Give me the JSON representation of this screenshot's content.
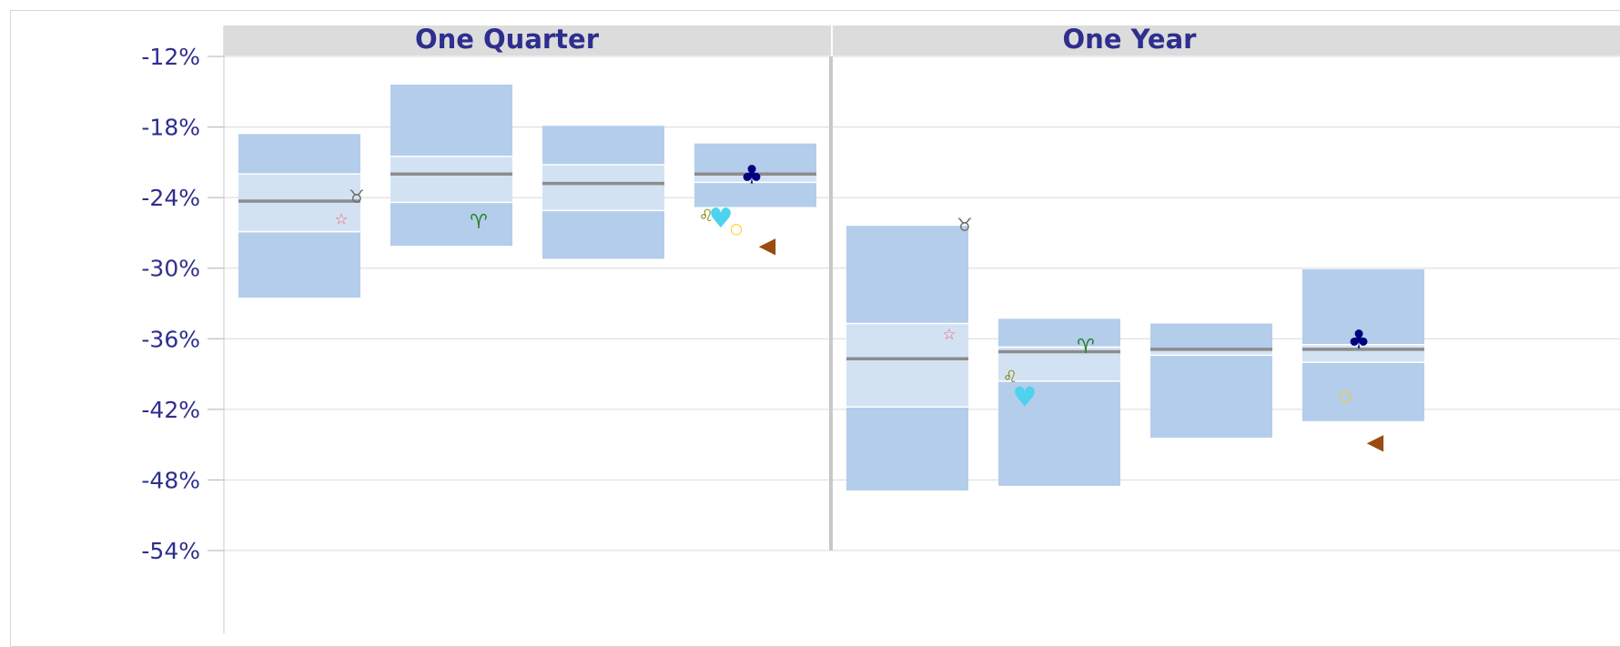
{
  "chart_data": {
    "type": "box",
    "panels": [
      "One Quarter",
      "One Year"
    ],
    "y_ticks": [
      "-12%",
      "-18%",
      "-24%",
      "-30%",
      "-36%",
      "-42%",
      "-48%",
      "-54%"
    ],
    "ylim": [
      -54,
      -12
    ],
    "grid": true,
    "colors": {
      "box_outer": "#b3cdeb",
      "box_inner": "#d3e2f3",
      "median": "#8c8c8c",
      "divider": "#c8c8c8",
      "header_bg": "#dcdcdc",
      "text": "#2e2e8f"
    },
    "boxes": [
      {
        "panel": 0,
        "slot": 0,
        "top": -18.6,
        "q3": -22,
        "median": -24.3,
        "q1": -26.9,
        "bottom": -32.5
      },
      {
        "panel": 0,
        "slot": 1,
        "top": -14.4,
        "q3": -20.5,
        "median": -22,
        "q1": -24.4,
        "bottom": -28.1
      },
      {
        "panel": 0,
        "slot": 2,
        "top": -17.9,
        "q3": -21.2,
        "median": -22.8,
        "q1": -25.1,
        "bottom": -29.2
      },
      {
        "panel": 0,
        "slot": 3,
        "top": -19.4,
        "q3": null,
        "median": -22,
        "q1": -22.7,
        "bottom": -24.8
      },
      {
        "panel": 1,
        "slot": 0,
        "top": -26.4,
        "q3": -34.7,
        "median": -37.7,
        "q1": -41.8,
        "bottom": -48.9
      },
      {
        "panel": 1,
        "slot": 1,
        "top": -34.3,
        "q3": -36.7,
        "median": -37.1,
        "q1": -39.6,
        "bottom": -48.5
      },
      {
        "panel": 1,
        "slot": 2,
        "top": -34.7,
        "q3": null,
        "median": -36.9,
        "q1": -37.4,
        "bottom": -44.4
      },
      {
        "panel": 1,
        "slot": 3,
        "top": -30.1,
        "q3": -36.5,
        "median": -36.9,
        "q1": -38,
        "bottom": -43
      }
    ],
    "markers": [
      {
        "panel": 0,
        "slot": 0,
        "symbol": "♉",
        "color": "#707070",
        "value": -23.9
      },
      {
        "panel": 0,
        "slot": 0,
        "symbol": "☆",
        "color": "#f06070",
        "value": -25.8
      },
      {
        "panel": 0,
        "slot": 1,
        "symbol": "♈",
        "color": "#2a7d2a",
        "value": -26
      },
      {
        "panel": 0,
        "slot": 3,
        "symbol": "♣",
        "color": "#000080",
        "value": -22
      },
      {
        "panel": 0,
        "slot": 3,
        "symbol": "♌",
        "color": "#808000",
        "value": -25.5
      },
      {
        "panel": 0,
        "slot": 3,
        "symbol": "♥",
        "color": "#4dd2f0",
        "value": -25.7
      },
      {
        "panel": 0,
        "slot": 3,
        "symbol": "○",
        "color": "#ffcc00",
        "value": -26.6
      },
      {
        "panel": 0,
        "slot": 3,
        "symbol": "◀",
        "color": "#9c4a10",
        "value": -28
      },
      {
        "panel": 1,
        "slot": 0,
        "symbol": "♉",
        "color": "#707070",
        "value": -26.3
      },
      {
        "panel": 1,
        "slot": 0,
        "symbol": "☆",
        "color": "#f06070",
        "value": -35.6
      },
      {
        "panel": 1,
        "slot": 1,
        "symbol": "♈",
        "color": "#2a7d2a",
        "value": -36.6
      },
      {
        "panel": 1,
        "slot": 1,
        "symbol": "♌",
        "color": "#808000",
        "value": -39.2
      },
      {
        "panel": 1,
        "slot": 1,
        "symbol": "♥",
        "color": "#4dd2f0",
        "value": -40.9
      },
      {
        "panel": 1,
        "slot": 3,
        "symbol": "♣",
        "color": "#000080",
        "value": -36
      },
      {
        "panel": 1,
        "slot": 3,
        "symbol": "○",
        "color": "#ffcc00",
        "value": -40.8
      },
      {
        "panel": 1,
        "slot": 3,
        "symbol": "◀",
        "color": "#9c4a10",
        "value": -44.7
      }
    ]
  }
}
